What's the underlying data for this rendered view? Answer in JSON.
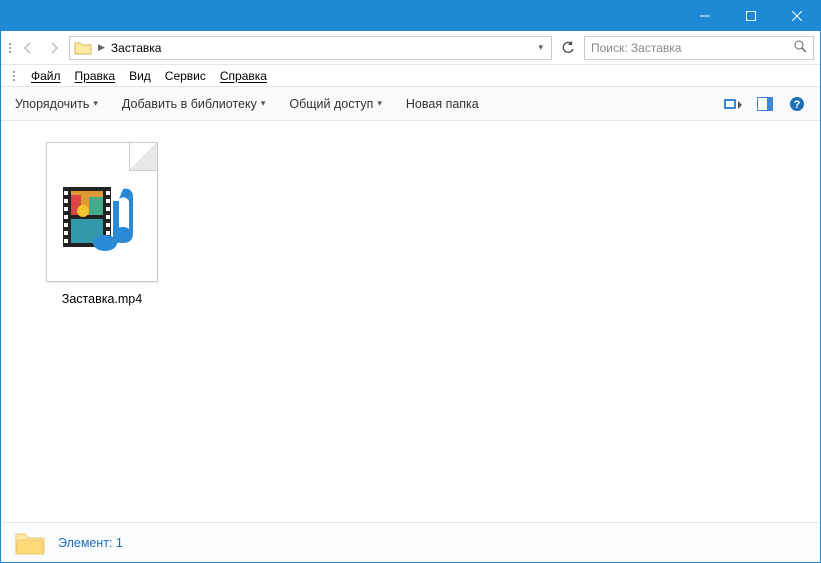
{
  "titlebar": {
    "minimize": "–",
    "maximize": "□",
    "close": "✕"
  },
  "nav": {
    "folder": "Заставка",
    "search_placeholder": "Поиск: Заставка"
  },
  "menus": {
    "file": "Файл",
    "edit": "Правка",
    "view": "Вид",
    "tools": "Сервис",
    "help": "Справка"
  },
  "toolbar": {
    "organize": "Упорядочить",
    "library": "Добавить в библиотеку",
    "share": "Общий доступ",
    "newfolder": "Новая папка"
  },
  "files": [
    {
      "name": "Заставка.mp4"
    }
  ],
  "statusbar": {
    "text": "Элемент: 1"
  }
}
